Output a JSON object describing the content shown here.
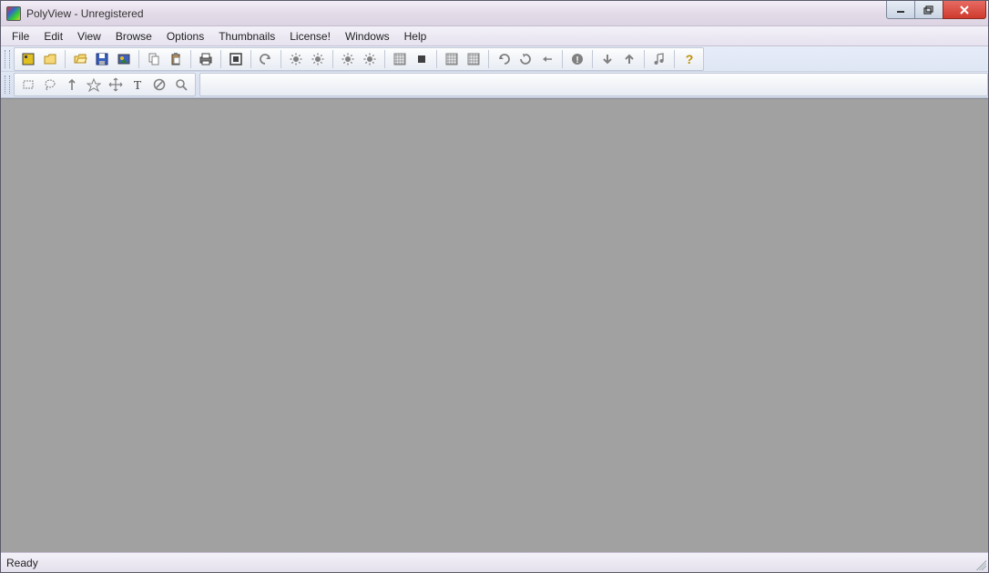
{
  "window": {
    "title": "PolyView - Unregistered"
  },
  "menu": {
    "items": [
      "File",
      "Edit",
      "View",
      "Browse",
      "Options",
      "Thumbnails",
      "License!",
      "Windows",
      "Help"
    ]
  },
  "toolbar1": {
    "icons": [
      "explorer-icon",
      "folder-icon",
      "sep",
      "open-icon",
      "save-icon",
      "slideshow-icon",
      "sep",
      "copy-icon",
      "paste-icon",
      "sep",
      "print-icon",
      "sep",
      "fullscreen-icon",
      "sep",
      "undo-icon",
      "sep",
      "brightness-down-icon",
      "brightness-up-icon",
      "sep",
      "contrast-down-icon",
      "contrast-up-icon",
      "sep",
      "grid1-icon",
      "stop-icon",
      "sep",
      "grid2-icon",
      "grid3-icon",
      "sep",
      "redo-icon",
      "rotate-icon",
      "flip-icon",
      "sep",
      "info-icon",
      "sep",
      "arrow-down-icon",
      "arrow-up-icon",
      "sep",
      "music-icon",
      "sep",
      "help-icon"
    ]
  },
  "toolbar2": {
    "icons": [
      "rect-select-icon",
      "lasso-icon",
      "arrow-n-icon",
      "star-icon",
      "move-icon",
      "text-icon",
      "nosymbol-icon",
      "zoom-icon"
    ]
  },
  "status": {
    "text": "Ready"
  }
}
